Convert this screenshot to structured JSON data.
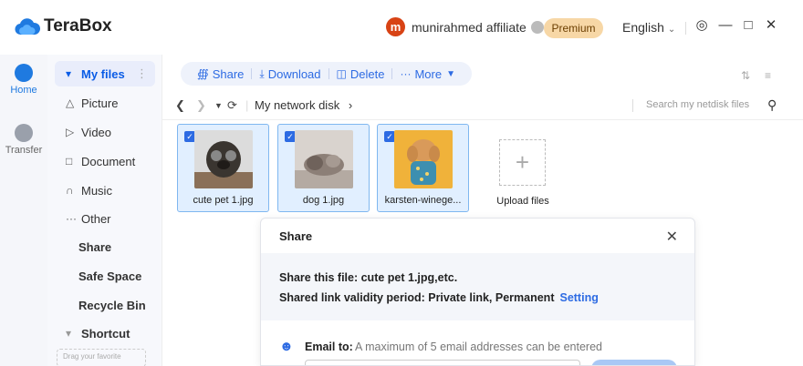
{
  "app": {
    "name": "TeraBox"
  },
  "header": {
    "avatar_letter": "m",
    "username": "munirahmed affiliate",
    "premium_label": "Premium",
    "language": "English",
    "accent": "#2d6be3"
  },
  "rail": {
    "items": [
      {
        "label": "Home",
        "icon": "cloud-home-icon"
      },
      {
        "label": "Transfer",
        "icon": "transfer-icon"
      }
    ]
  },
  "sidebar": {
    "my_files": "My files",
    "items": [
      {
        "label": "Picture",
        "icon": "picture-icon"
      },
      {
        "label": "Video",
        "icon": "video-icon"
      },
      {
        "label": "Document",
        "icon": "document-icon"
      },
      {
        "label": "Music",
        "icon": "music-icon"
      },
      {
        "label": "Other",
        "icon": "other-icon"
      }
    ],
    "share": "Share",
    "safe_space": "Safe Space",
    "recycle_bin": "Recycle Bin",
    "shortcut": "Shortcut",
    "drag_hint": "Drag your favorite"
  },
  "toolbar": {
    "share": "Share",
    "download": "Download",
    "delete": "Delete",
    "more": "More"
  },
  "pathbar": {
    "path": "My network disk",
    "search_placeholder": "Search my netdisk files"
  },
  "files": [
    {
      "name": "cute pet 1.jpg",
      "selected": true
    },
    {
      "name": "dog 1.jpg",
      "selected": true
    },
    {
      "name": "karsten-winege...",
      "selected": true
    }
  ],
  "upload_label": "Upload files",
  "share_dialog": {
    "title": "Share",
    "file_line": "Share this file: cute pet 1.jpg,etc.",
    "validity_line": "Shared link validity period: Private link, Permanent",
    "setting": "Setting",
    "email_label": "Email to:",
    "email_placeholder": "A maximum of 5 email addresses can be entered"
  }
}
